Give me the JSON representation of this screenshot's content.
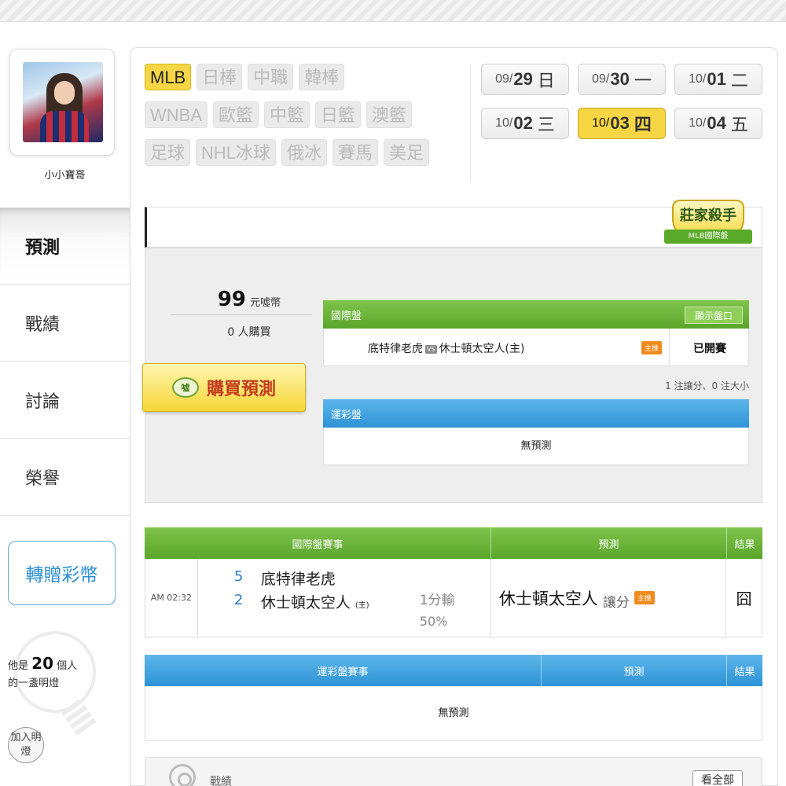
{
  "user": {
    "name": "小小寶哥"
  },
  "nav": {
    "predict": "預測",
    "record": "戰績",
    "discuss": "討論",
    "honor": "榮譽"
  },
  "gift_button": "轉贈彩幣",
  "lamp": {
    "prefix": "他是",
    "count": "20",
    "suffix": "個人",
    "line2": "的一盞明燈",
    "join": "加入明燈"
  },
  "sports": {
    "row1": [
      "MLB",
      "日棒",
      "中職",
      "韓棒"
    ],
    "row2": [
      "WNBA",
      "歐籃",
      "中籃",
      "日籃",
      "澳籃"
    ],
    "row3": [
      "足球",
      "NHL冰球",
      "俄冰",
      "賽馬",
      "美足"
    ],
    "active": "MLB"
  },
  "dates": [
    {
      "m": "09/",
      "d": "29",
      "w": "日"
    },
    {
      "m": "09/",
      "d": "30",
      "w": "一"
    },
    {
      "m": "10/",
      "d": "01",
      "w": "二"
    },
    {
      "m": "10/",
      "d": "02",
      "w": "三"
    },
    {
      "m": "10/",
      "d": "03",
      "w": "四",
      "active": true
    },
    {
      "m": "10/",
      "d": "04",
      "w": "五"
    }
  ],
  "badge": {
    "title": "莊家殺手",
    "sub": "MLB國際盤"
  },
  "purchase": {
    "price": "99",
    "unit": "元噓幣",
    "buyers": "0 人購買",
    "buy_label": "購買預測",
    "coin_label": "噓"
  },
  "intl_panel": {
    "title": "國際盤",
    "show_odds": "顯示盤口",
    "away": "底特律老虎",
    "vs": "VS",
    "home": "休士頓太空人(主)",
    "tag": "主推",
    "status": "已開賽",
    "note": "1 注讓分、0 注大小"
  },
  "lottery_panel": {
    "title": "運彩盤",
    "empty": "無預測"
  },
  "intl_table": {
    "headers": [
      "國際盤賽事",
      "預測",
      "結果"
    ],
    "time": "AM 02:32",
    "away_score": "5",
    "away_team": "底特律老虎",
    "home_score": "2",
    "home_team": "休士頓太空人",
    "home_mark": "(主)",
    "line": "1分輸",
    "pct": "50%",
    "pick": "休士頓太空人",
    "pick_type": "讓分",
    "pick_tag": "主推",
    "result": "囧"
  },
  "lottery_table": {
    "headers": [
      "運彩盤賽事",
      "預測",
      "結果"
    ],
    "empty": "無預測"
  },
  "record_bar": {
    "label": "戰績",
    "see_all": "看全部"
  }
}
